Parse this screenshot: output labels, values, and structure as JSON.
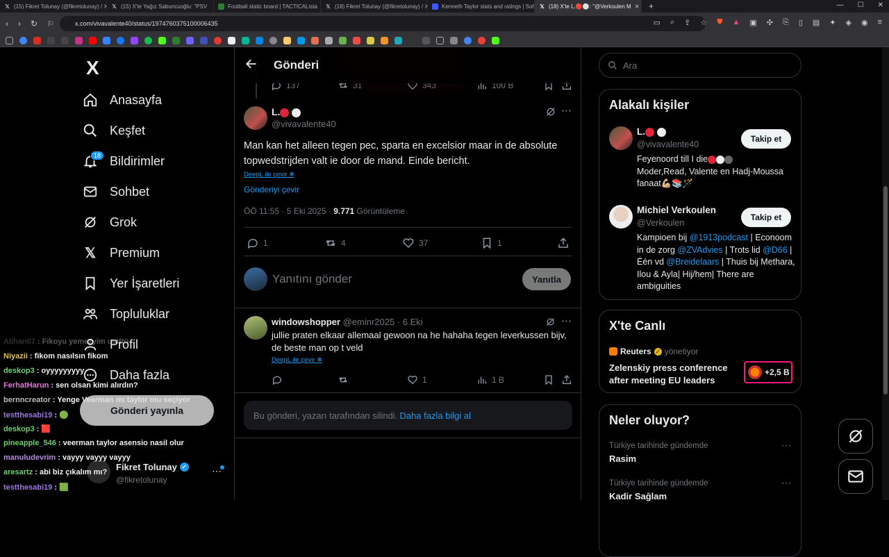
{
  "browser": {
    "tabs": [
      {
        "label": "(15) Fikret Tolunay (@fikretolunay) / X",
        "icon": "x-logo"
      },
      {
        "label": "(15) X'te Yağız Sabuncuoğlu: \"PSV",
        "icon": "x-logo"
      },
      {
        "label": "Football static board | TACTICALista",
        "icon": "board"
      },
      {
        "label": "(18) Fikret Tolunay (@fikretolunay) / X",
        "icon": "x-logo"
      },
      {
        "label": "Kenneth Taylor stats and ratings | Sofa",
        "icon": "sofascore"
      },
      {
        "label": "(18) X'te L.🔴⚪: \"@Verkoulen M",
        "icon": "x-logo"
      }
    ],
    "active_tab": 5,
    "url": "x.com/vivavalente40/status/1974760375100006435"
  },
  "nav": {
    "logo": "X",
    "items": [
      {
        "label": "Anasayfa",
        "icon": "home-icon"
      },
      {
        "label": "Keşfet",
        "icon": "search-icon"
      },
      {
        "label": "Bildirimler",
        "icon": "bell-icon",
        "badge": "18"
      },
      {
        "label": "Sohbet",
        "icon": "mail-icon"
      },
      {
        "label": "Grok",
        "icon": "grok-icon"
      },
      {
        "label": "Premium",
        "icon": "x-icon"
      },
      {
        "label": "Yer İşaretleri",
        "icon": "bookmark-icon"
      },
      {
        "label": "Topluluklar",
        "icon": "people-icon"
      },
      {
        "label": "Profil",
        "icon": "person-icon"
      },
      {
        "label": "Daha fazla",
        "icon": "more-icon"
      }
    ],
    "post_button": "Gönderi yayınla",
    "account": {
      "name": "Fikret Tolunay",
      "handle": "@fikretolunay"
    }
  },
  "header": {
    "title": "Gönderi"
  },
  "prev_tweet_actions": {
    "replies": "137",
    "retweets": "31",
    "likes": "343",
    "views": "100 B"
  },
  "main_tweet": {
    "name": "L.",
    "handle": "@vivavalente40",
    "text": "Man kan het alleen tegen pec, sparta en excelsior maar in de absolute topwedstrijden valt ie door de mand. Einde bericht.",
    "deepl": "DeepL ile çevir",
    "translate": "Gönderiyi çevir",
    "time": "ÖÖ 11:55 · 5 Eki 2025 · ",
    "views_count": "9.771",
    "views_label": " Görüntüleme",
    "replies": "1",
    "retweets": "4",
    "likes": "37",
    "bookmarks": "1"
  },
  "reply_box": {
    "placeholder": "Yanıtını gönder",
    "button": "Yanıtla"
  },
  "reply": {
    "name": "windowshopper",
    "handle": "@eminr2025",
    "date": "· 6 Eki",
    "text": "jullie praten elkaar allemaal gewoon na he hahaha tegen leverkussen bijv, de beste man op t veld",
    "deepl": "DeepL ile çevir",
    "likes": "1",
    "views": "1 B"
  },
  "deleted": {
    "text": "Bu gönderi, yazarı tarafından silindi. ",
    "link": "Daha fazla bilgi al"
  },
  "search": {
    "placeholder": "Ara"
  },
  "related": {
    "title": "Alakalı kişiler",
    "people": [
      {
        "name": "L.",
        "handle": "@vivavalente40",
        "button": "Takip et",
        "bio_parts": [
          "Feyenoord till I die",
          "Moder,Read, Valente en Hadj-Moussa fanaat💪🏼📚🪄"
        ]
      },
      {
        "name": "Michiel Verkoulen",
        "handle": "@Verkoulen",
        "button": "Takip et",
        "bio_segments": [
          {
            "t": "Kampioen bij ",
            "link": false
          },
          {
            "t": "@1913podcast",
            "link": true
          },
          {
            "t": " | Econoom in de zorg ",
            "link": false
          },
          {
            "t": "@ZVAdvies",
            "link": true
          },
          {
            "t": " | Trots lid ",
            "link": false
          },
          {
            "t": "@D66",
            "link": true
          },
          {
            "t": " | Één vd ",
            "link": false
          },
          {
            "t": "@Breidelaars",
            "link": true
          },
          {
            "t": " | Thuis bij Methara, Ilou & Ayla| Hij/hem| There are ambiguities",
            "link": false
          }
        ]
      }
    ]
  },
  "live": {
    "title": "X'te Canlı",
    "host": "Reuters",
    "host_suffix": "yönetiyor",
    "headline": "Zelenskiy press conference after meeting EU leaders",
    "count": "+2,5 B"
  },
  "trends": {
    "title": "Neler oluyor?",
    "items": [
      {
        "context": "Türkiye tarihinde gündemde",
        "name": "Rasim"
      },
      {
        "context": "Türkiye tarihinde gündemde",
        "name": "Kadir Sağlam"
      }
    ]
  },
  "chat_overlay": [
    {
      "user": "Alihan07",
      "msg": "Fikoyu yemezyim ustttü",
      "color": "#8a8a8a",
      "faded": true
    },
    {
      "user": "Niyazii",
      "msg": "fikom nasılsın fikom",
      "color": "#e6c34a"
    },
    {
      "user": "deskop3",
      "msg": "oyyyyyyyyy",
      "color": "#6ccf6c"
    },
    {
      "user": "FerhatHarun",
      "msg": "sen olsan kimi alırdın?",
      "color": "#e07ad6"
    },
    {
      "user": "bernncreator",
      "msg": "Yenge Veerman mı taylor mu seçiyor",
      "color": "#bbbbbb"
    },
    {
      "user": "testthesabi19",
      "msg": "🟢",
      "color": "#9b7ae0"
    },
    {
      "user": "deskop3",
      "msg": "🟥",
      "color": "#6ccf6c"
    },
    {
      "user": "pineapple_546",
      "msg": "veerman taylor asensio nasil olur",
      "color": "#6ccf6c"
    },
    {
      "user": "manuludevrim",
      "msg": "vayyy vayyy vayyy",
      "color": "#b48ae0"
    },
    {
      "user": "aresartz",
      "msg": "abi biz çıkalım mı?",
      "color": "#6ccf6c"
    },
    {
      "user": "testthesabi19",
      "msg": "🟩",
      "color": "#9b7ae0"
    }
  ]
}
